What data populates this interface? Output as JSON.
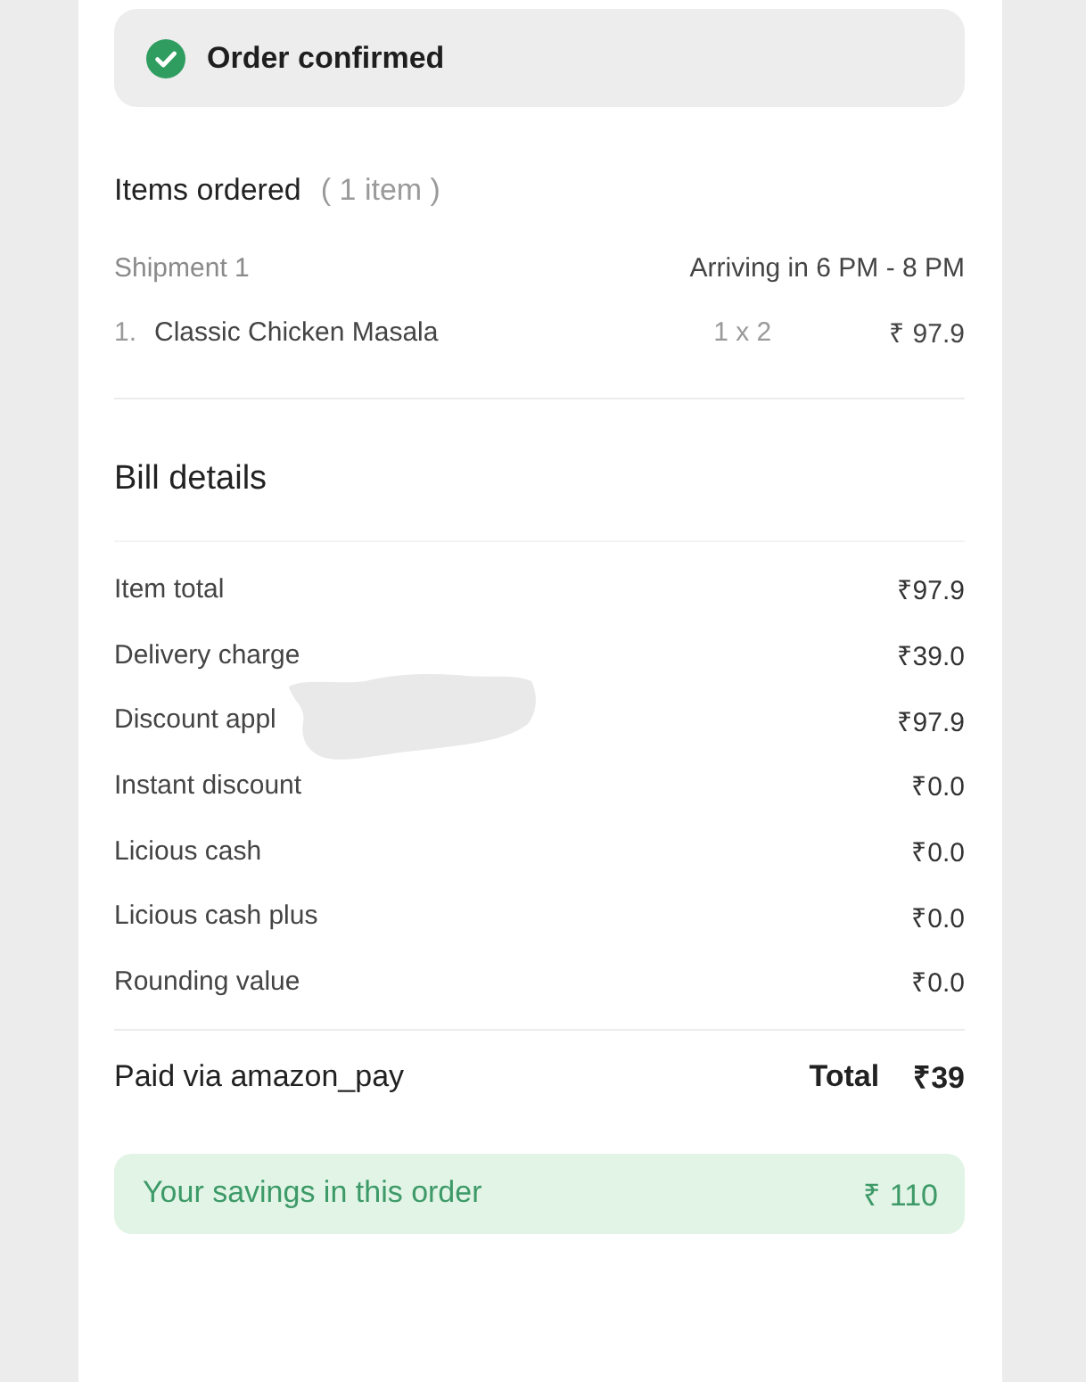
{
  "status": {
    "kind": "success",
    "text": "Order confirmed"
  },
  "items_section": {
    "title": "Items ordered",
    "count": "( 1 item )"
  },
  "shipments": [
    {
      "label": "Shipment 1",
      "arrival": "Arriving in 6 PM - 8 PM",
      "items": [
        {
          "index": "1.",
          "name": "Classic Chicken Masala",
          "quantity": "1 x 2",
          "price": "₹ 97.9"
        }
      ]
    }
  ],
  "bill": {
    "title": "Bill details",
    "rows": [
      {
        "label": "Item total",
        "value": "₹97.9",
        "redacted": false
      },
      {
        "label": "Delivery charge",
        "value": "₹39.0",
        "redacted": false
      },
      {
        "label": "Discount appl",
        "value": "₹97.9",
        "redacted": true
      },
      {
        "label": "Instant discount",
        "value": "₹0.0",
        "redacted": false
      },
      {
        "label": "Licious cash",
        "value": "₹0.0",
        "redacted": false
      },
      {
        "label": "Licious cash plus",
        "value": "₹0.0",
        "redacted": false
      },
      {
        "label": "Rounding value",
        "value": "₹0.0",
        "redacted": false
      }
    ]
  },
  "payment": {
    "method": "Paid via amazon_pay",
    "total_label": "Total",
    "total_value": "₹39"
  },
  "savings": {
    "label": "Your savings in this order",
    "value": "₹ 110"
  }
}
